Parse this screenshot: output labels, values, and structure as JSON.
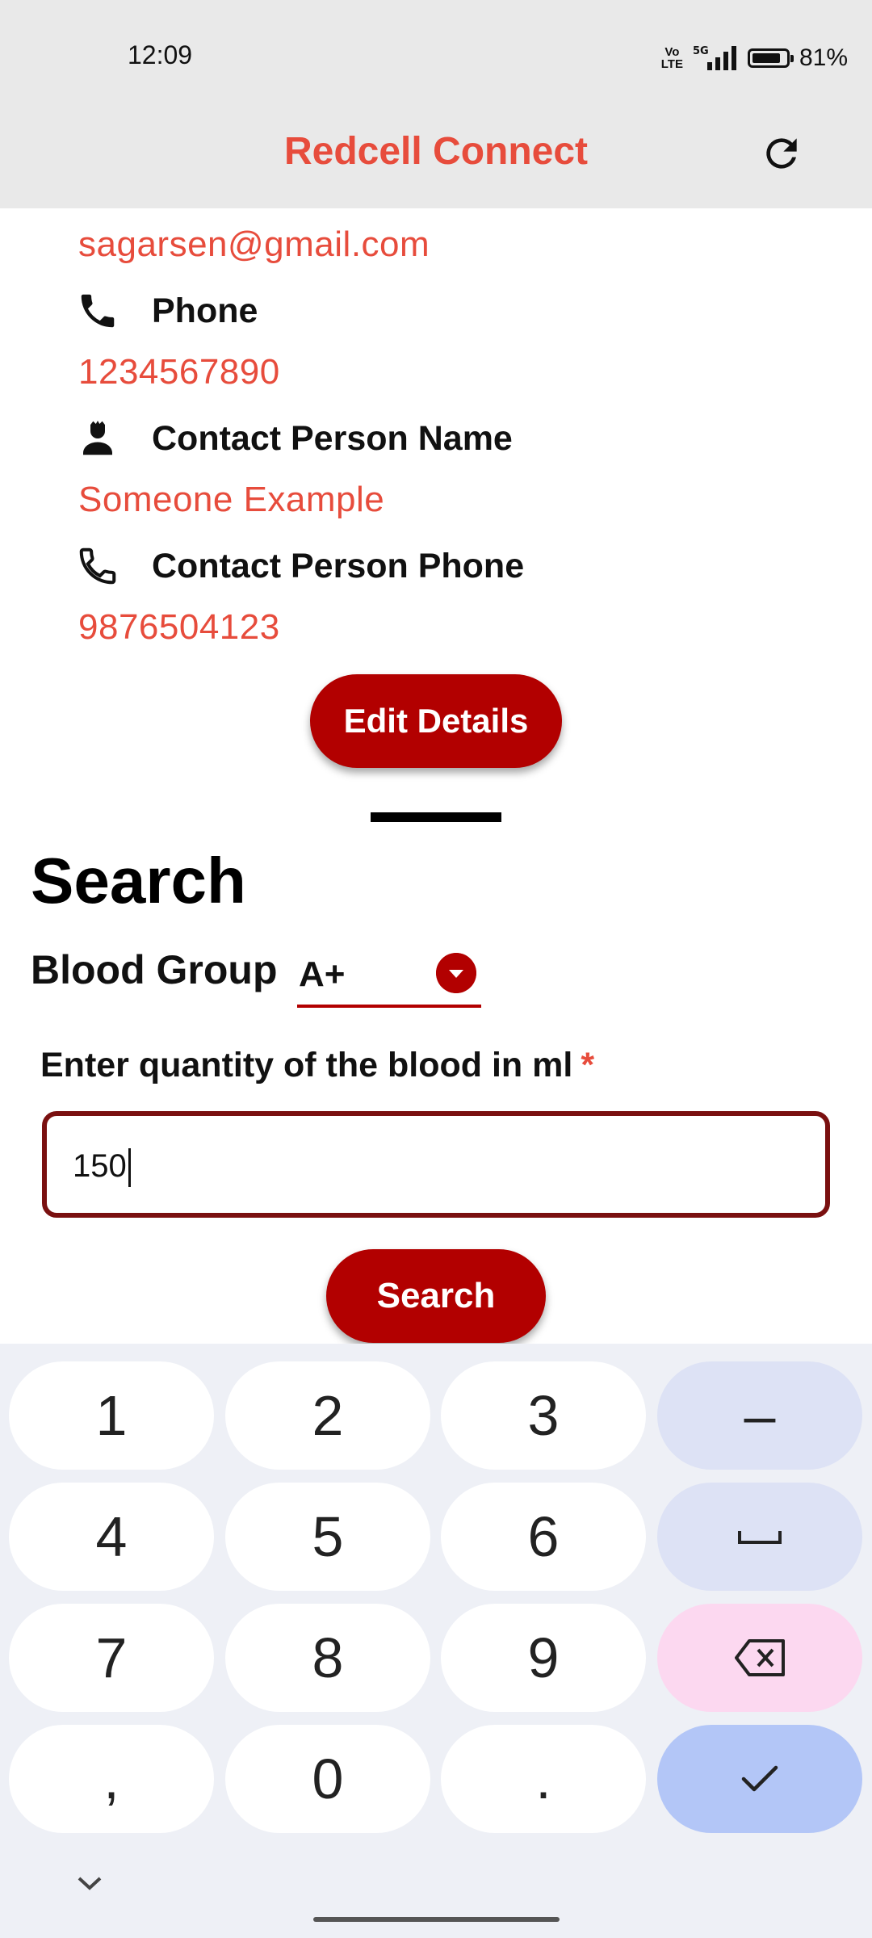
{
  "status_bar": {
    "time": "12:09",
    "network": "5G",
    "volte": "Vo\nLTE",
    "battery": "81%"
  },
  "app_bar": {
    "title": "Redcell Connect",
    "refresh_icon": "refresh-icon"
  },
  "profile": {
    "email_value": "sagarsen@gmail.com",
    "phone_label": "Phone",
    "phone_value": "1234567890",
    "contact_name_label": "Contact Person Name",
    "contact_name_value": "Someone Example",
    "contact_phone_label": "Contact Person Phone",
    "contact_phone_value": "9876504123",
    "edit_button": "Edit Details"
  },
  "search": {
    "title": "Search",
    "blood_group_label": "Blood Group",
    "blood_group_value": "A+",
    "quantity_label": "Enter quantity of the blood in ml",
    "required_mark": "*",
    "quantity_value": "150",
    "search_button": "Search"
  },
  "keyboard": {
    "rows": [
      [
        "1",
        "2",
        "3",
        "–"
      ],
      [
        "4",
        "5",
        "6",
        "␣"
      ],
      [
        "7",
        "8",
        "9",
        "⌫"
      ],
      [
        ",",
        "0",
        ".",
        "✓"
      ]
    ]
  },
  "colors": {
    "accent_red": "#e74c3c",
    "button_red": "#b20000",
    "input_border": "#7a1010"
  }
}
